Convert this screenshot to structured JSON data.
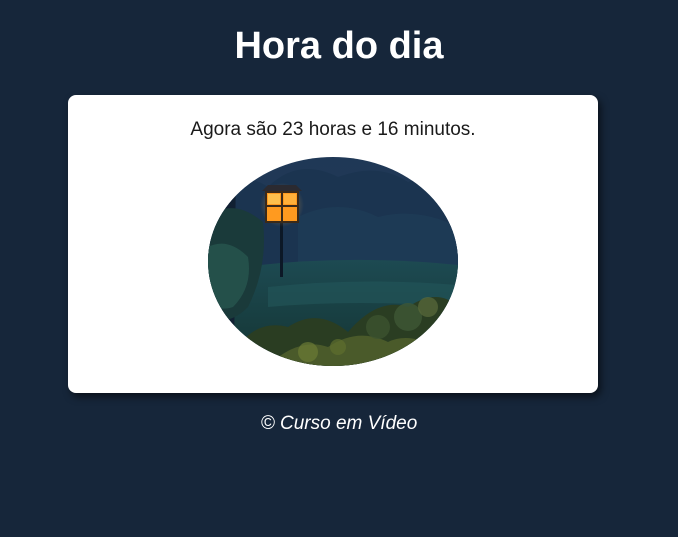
{
  "page": {
    "title": "Hora do dia",
    "message": "Agora são 23 horas e 16 minutos.",
    "footer": "© Curso em Vídeo"
  },
  "image": {
    "icon": "night-garden-lantern-photo"
  },
  "colors": {
    "background": "#16263a",
    "card": "#ffffff",
    "title_text": "#ffffff",
    "body_text": "#1a1a1a"
  }
}
